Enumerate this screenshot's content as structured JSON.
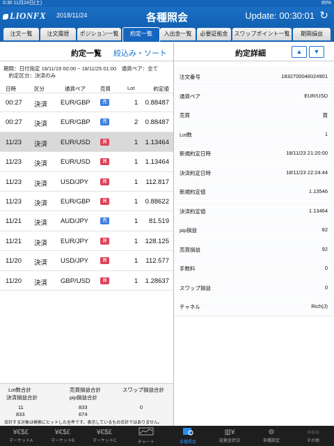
{
  "status": {
    "time_date": "0:30  11月24日(土)",
    "battery": "65%"
  },
  "header": {
    "logo": "LIONFX",
    "date": "2018/11/24",
    "title": "各種照会",
    "update": "Update: 00:30:01",
    "refresh_icon": "refresh-icon"
  },
  "tabs": [
    "注文一覧",
    "注文履歴",
    "ポジション一覧",
    "約定一覧",
    "入出金一覧",
    "必要証拠金",
    "スワップポイント一覧",
    "期間損益"
  ],
  "left": {
    "title": "約定一覧",
    "filter_link": "絞込み・ソート",
    "condition_line1": "期間：日付指定 18/11/19 00:00 ~ 18/11/25 01:00　通貨ペア：全て",
    "condition_line2": "　約定区分：決済のみ",
    "columns": {
      "time": "日時",
      "category": "区分",
      "pair": "通貨ペア",
      "side": "売買",
      "lot": "Lot",
      "price": "約定値"
    },
    "rows": [
      {
        "time": "00:27",
        "category": "決済",
        "pair": "EUR/GBP",
        "side": "売",
        "lot": "1",
        "price": "0.88487"
      },
      {
        "time": "00:27",
        "category": "決済",
        "pair": "EUR/GBP",
        "side": "売",
        "lot": "2",
        "price": "0.88487"
      },
      {
        "time": "11/23",
        "category": "決済",
        "pair": "EUR/USD",
        "side": "買",
        "lot": "1",
        "price": "1.13464"
      },
      {
        "time": "11/23",
        "category": "決済",
        "pair": "EUR/USD",
        "side": "買",
        "lot": "1",
        "price": "1.13464"
      },
      {
        "time": "11/23",
        "category": "決済",
        "pair": "USD/JPY",
        "side": "買",
        "lot": "1",
        "price": "112.817"
      },
      {
        "time": "11/23",
        "category": "決済",
        "pair": "EUR/GBP",
        "side": "買",
        "lot": "1",
        "price": "0.88622"
      },
      {
        "time": "11/21",
        "category": "決済",
        "pair": "AUD/JPY",
        "side": "売",
        "lot": "1",
        "price": "81.519"
      },
      {
        "time": "11/21",
        "category": "決済",
        "pair": "EUR/JPY",
        "side": "買",
        "lot": "1",
        "price": "128.125"
      },
      {
        "time": "11/20",
        "category": "決済",
        "pair": "USD/JPY",
        "side": "買",
        "lot": "1",
        "price": "112.577"
      },
      {
        "time": "11/20",
        "category": "決済",
        "pair": "GBP/USD",
        "side": "買",
        "lot": "1",
        "price": "1.28637"
      }
    ],
    "sums": {
      "lot_label": "Lot数合計",
      "pl_label": "売買損益合計",
      "swap_label": "スワップ損益合計",
      "settle_label": "決済損益合計",
      "pip_label": "pip損益合計",
      "lot": "11",
      "pl": "833",
      "swap": "0",
      "settle": "833",
      "pip": "674",
      "note": "合計する対象は検索にヒットした全件です。表示しているもの合計ではありません。"
    }
  },
  "right": {
    "title": "約定詳細",
    "up_icon": "▲",
    "down_icon": "▼",
    "details": [
      {
        "label": "注文番号",
        "value": "1832700046024901"
      },
      {
        "label": "通貨ペア",
        "value": "EUR/USD"
      },
      {
        "label": "売買",
        "value": "買"
      },
      {
        "label": "Lot数",
        "value": "1"
      },
      {
        "label": "新規約定日時",
        "value": "18/11/23 21:20:00"
      },
      {
        "label": "決済約定日時",
        "value": "18/11/23 22:24:44"
      },
      {
        "label": "新規約定値",
        "value": "1.13546"
      },
      {
        "label": "決済約定値",
        "value": "1.13464"
      },
      {
        "label": "pip損益",
        "value": "82"
      },
      {
        "label": "売買損益",
        "value": "92"
      },
      {
        "label": "手数料",
        "value": "0"
      },
      {
        "label": "スワップ損益",
        "value": "0"
      },
      {
        "label": "チャネル",
        "value": "Rich(J)"
      }
    ]
  },
  "tabbar": [
    {
      "label": "マーケットA",
      "icon": "¥€$£"
    },
    {
      "label": "マーケットB",
      "icon": "¥€$£"
    },
    {
      "label": "マーケットC",
      "icon": "¥€$£"
    },
    {
      "label": "チャート",
      "icon": "chart-icon"
    },
    {
      "label": "各種照会",
      "icon": "inquiry-icon"
    },
    {
      "label": "証拠金状況",
      "icon": "margin-icon"
    },
    {
      "label": "各種設定",
      "icon": "settings-icon"
    },
    {
      "label": "その他",
      "icon": "more-icon"
    }
  ],
  "colors": {
    "brand": "#1262b5",
    "sell_badge": "#3d7ee0",
    "buy_badge": "#e0405a",
    "active_tab_bar": "#2a8cf0"
  }
}
